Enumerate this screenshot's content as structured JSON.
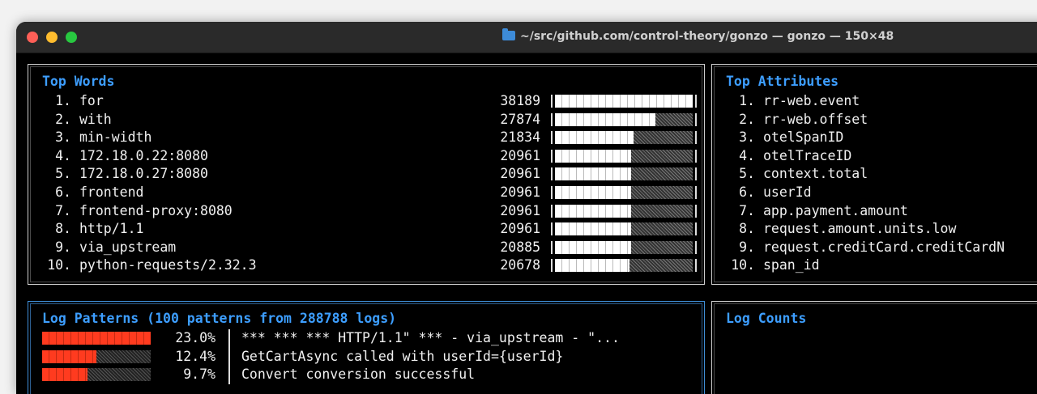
{
  "window": {
    "title": "~/src/github.com/control-theory/gonzo — gonzo — 150×48"
  },
  "top_words": {
    "title": "Top Words",
    "items": [
      {
        "rank": "1.",
        "word": "for",
        "count": "38189",
        "fraction": 1.0
      },
      {
        "rank": "2.",
        "word": "with",
        "count": "27874",
        "fraction": 0.73
      },
      {
        "rank": "3.",
        "word": "min-width",
        "count": "21834",
        "fraction": 0.57
      },
      {
        "rank": "4.",
        "word": "172.18.0.22:8080",
        "count": "20961",
        "fraction": 0.55
      },
      {
        "rank": "5.",
        "word": "172.18.0.27:8080",
        "count": "20961",
        "fraction": 0.55
      },
      {
        "rank": "6.",
        "word": "frontend",
        "count": "20961",
        "fraction": 0.55
      },
      {
        "rank": "7.",
        "word": "frontend-proxy:8080",
        "count": "20961",
        "fraction": 0.55
      },
      {
        "rank": "8.",
        "word": "http/1.1",
        "count": "20961",
        "fraction": 0.55
      },
      {
        "rank": "9.",
        "word": "via_upstream",
        "count": "20885",
        "fraction": 0.55
      },
      {
        "rank": "10.",
        "word": "python-requests/2.32.3",
        "count": "20678",
        "fraction": 0.54
      }
    ]
  },
  "top_attributes": {
    "title": "Top Attributes",
    "items": [
      {
        "rank": "1.",
        "name": "rr-web.event"
      },
      {
        "rank": "2.",
        "name": "rr-web.offset"
      },
      {
        "rank": "3.",
        "name": "otelSpanID"
      },
      {
        "rank": "4.",
        "name": "otelTraceID"
      },
      {
        "rank": "5.",
        "name": "context.total"
      },
      {
        "rank": "6.",
        "name": "userId"
      },
      {
        "rank": "7.",
        "name": "app.payment.amount"
      },
      {
        "rank": "8.",
        "name": "request.amount.units.low"
      },
      {
        "rank": "9.",
        "name": "request.creditCard.creditCardN"
      },
      {
        "rank": "10.",
        "name": "span_id"
      }
    ]
  },
  "log_patterns": {
    "title": "Log Patterns (100 patterns from 288788 logs)",
    "items": [
      {
        "percent": "23.0%",
        "fraction": 1.0,
        "pattern": "*** *** *** HTTP/1.1\" *** - via_upstream - \"..."
      },
      {
        "percent": "12.4%",
        "fraction": 0.5,
        "pattern": "GetCartAsync called with userId={userId}"
      },
      {
        "percent": "9.7%",
        "fraction": 0.42,
        "pattern": "Convert conversion successful"
      }
    ]
  },
  "log_counts": {
    "title": "Log Counts"
  }
}
